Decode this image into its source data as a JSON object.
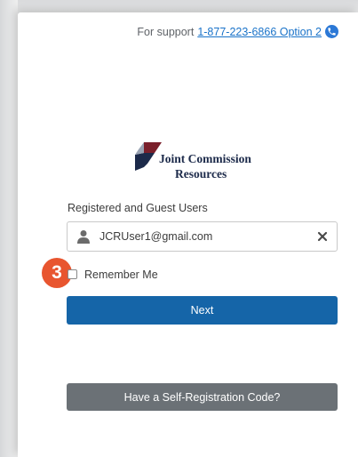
{
  "support": {
    "prefix": "For support",
    "phone_link": "1-877-223-6866 Option 2"
  },
  "logo": {
    "line1": "Joint Commission",
    "line2": "Resources"
  },
  "login": {
    "field_label": "Registered and Guest Users",
    "username_value": "JCRUser1@gmail.com",
    "remember_label": "Remember Me",
    "next_label": "Next",
    "self_registration_label": "Have a Self-Registration Code?"
  },
  "callout": {
    "step_number": "3"
  },
  "colors": {
    "primary_button": "#1565a8",
    "secondary_button": "#6b7176",
    "step_badge": "#e8552f",
    "link": "#1a73c9"
  },
  "icons": {
    "phone": "phone-icon",
    "user": "user-icon",
    "clear": "close-icon"
  }
}
